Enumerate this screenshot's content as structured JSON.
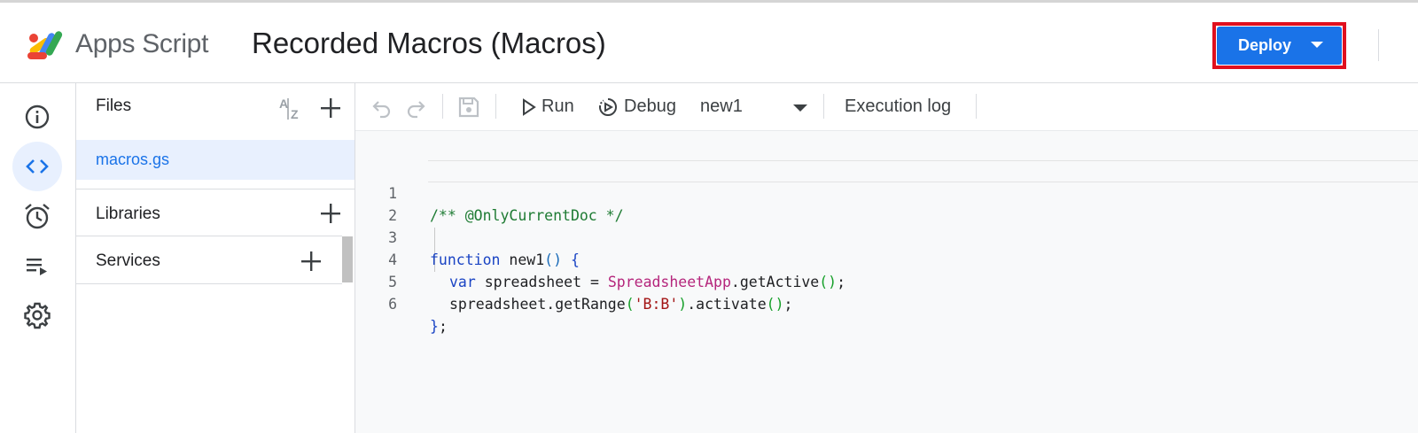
{
  "header": {
    "app_name": "Apps Script",
    "project_title": "Recorded Macros (Macros)",
    "deploy_label": "Deploy"
  },
  "left_nav": {
    "items": [
      "info-icon",
      "code-icon",
      "alarm-clock-icon",
      "executions-icon",
      "settings-gear-icon"
    ],
    "active_index": 1
  },
  "files_panel": {
    "files_title": "Files",
    "files": [
      "macros.gs"
    ],
    "libraries_title": "Libraries",
    "services_title": "Services"
  },
  "toolbar": {
    "run_label": "Run",
    "debug_label": "Debug",
    "function_selected": "new1",
    "execution_log_label": "Execution log"
  },
  "editor": {
    "line_numbers": [
      "1",
      "2",
      "3",
      "4",
      "5",
      "6"
    ],
    "tokens": {
      "l1_comment": "/** @OnlyCurrentDoc */",
      "l3_kw": "function",
      "l3_name": " new1",
      "l3_paren": "()",
      "l3_brace": " {",
      "l4_kw": "var",
      "l4_ident": " spreadsheet = ",
      "l4_cls": "SpreadsheetApp",
      "l4_method": ".getActive",
      "l4_paren": "()",
      "l4_end": ";",
      "l5_a": "spreadsheet.getRange",
      "l5_p1": "(",
      "l5_str": "'B:B'",
      "l5_p2": ")",
      "l5_b": ".activate",
      "l5_p3": "()",
      "l5_end": ";",
      "l6_brace": "}",
      "l6_end": ";"
    }
  },
  "colors": {
    "accent": "#1a73e8",
    "highlight_outline": "#e0101e",
    "active_nav_bg": "#e8f0fe"
  }
}
